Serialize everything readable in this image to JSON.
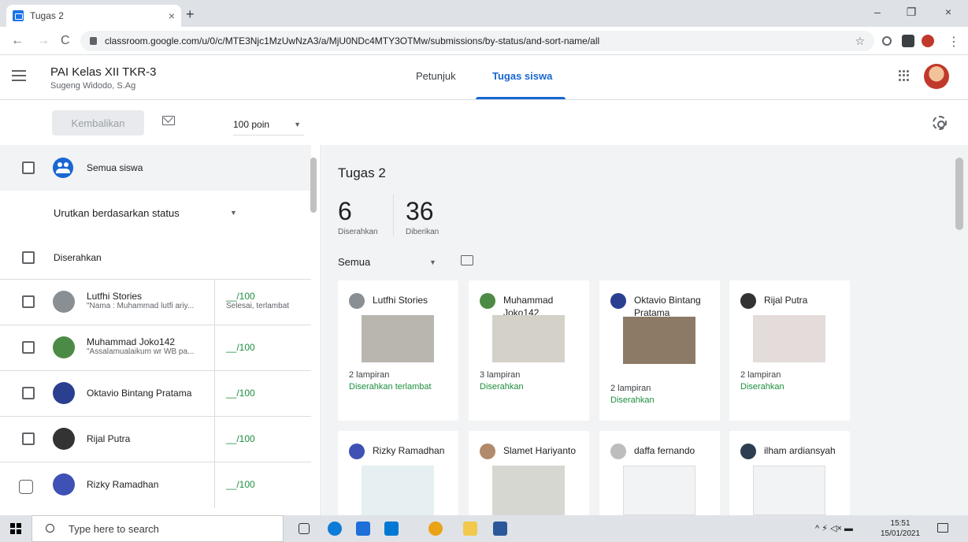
{
  "browser": {
    "tab_title": "Tugas 2",
    "tab_close": "×",
    "new_tab": "+",
    "url": "classroom.google.com/u/0/c/MTE3Njc1MzUwNzA3/a/MjU0NDc4MTY3OTMw/submissions/by-status/and-sort-name/all",
    "back": "←",
    "forward": "→",
    "reload": "C",
    "star": "☆",
    "menu": "⋮",
    "minimize": "–",
    "restore": "❐",
    "close": "×"
  },
  "header": {
    "class_name": "PAI Kelas XII TKR-3",
    "teacher": "Sugeng Widodo, S.Ag",
    "tabs": [
      {
        "label": "Petunjuk"
      },
      {
        "label": "Tugas siswa"
      }
    ]
  },
  "toolbar": {
    "return_label": "Kembalikan",
    "points": "100 poin",
    "points_arrow": "▼"
  },
  "left": {
    "all_students": "Semua siswa",
    "sort_label": "Urutkan berdasarkan status",
    "sort_arrow": "▼",
    "section": "Diserahkan",
    "students": [
      {
        "name": "Lutfhi Stories",
        "note": "\"Nama : Muhammad lutfi ariy...",
        "grade": "__/100",
        "status": "Selesai, terlambat",
        "avatar_color": "#8a8f94"
      },
      {
        "name": "Muhammad Joko142",
        "note": "\"Assalamualaikum wr WB pa...",
        "grade": "__/100",
        "status": "",
        "avatar_color": "#4c8b45"
      },
      {
        "name": "Oktavio Bintang Pratama",
        "note": "",
        "grade": "__/100",
        "status": "",
        "avatar_color": "#2a3f8f"
      },
      {
        "name": "Rijal Putra",
        "note": "",
        "grade": "__/100",
        "status": "",
        "avatar_color": "#333333"
      },
      {
        "name": "Rizky Ramadhan",
        "note": "",
        "grade": "__/100",
        "status": "",
        "avatar_color": "#3f51b5"
      }
    ]
  },
  "main": {
    "assignment_title": "Tugas 2",
    "turned_in_count": "6",
    "turned_in_label": "Diserahkan",
    "assigned_count": "36",
    "assigned_label": "Diberikan",
    "filter": "Semua",
    "filter_arrow": "▼",
    "cards": [
      {
        "name": "Lutfhi Stories",
        "attachments": "2 lampiran",
        "status": "Diserahkan terlambat",
        "avatar_color": "#8a8f94",
        "thumb_color": "#b9b6b0"
      },
      {
        "name": "Muhammad Joko142",
        "attachments": "3 lampiran",
        "status": "Diserahkan",
        "avatar_color": "#4c8b45",
        "thumb_color": "#d4d1c9"
      },
      {
        "name": "Oktavio Bintang Pratama",
        "attachments": "2 lampiran",
        "status": "Diserahkan",
        "avatar_color": "#2a3f8f",
        "thumb_color": "#8d7a66"
      },
      {
        "name": "Rijal Putra",
        "attachments": "2 lampiran",
        "status": "Diserahkan",
        "avatar_color": "#333333",
        "thumb_color": "#e4dcda"
      },
      {
        "name": "Rizky Ramadhan",
        "attachments": "",
        "status": "",
        "avatar_color": "#3f51b5",
        "thumb_color": "#e6eff2"
      },
      {
        "name": "Slamet Hariyanto",
        "attachments": "",
        "status": "",
        "avatar_color": "#b08a6a",
        "thumb_color": "#d7d7d2"
      },
      {
        "name": "daffa fernando",
        "attachments": "",
        "status": "",
        "avatar_color": "#bdbdbd",
        "thumb_color": "#f1f3f4"
      },
      {
        "name": "ilham ardiansyah",
        "attachments": "",
        "status": "",
        "avatar_color": "#2c3e50",
        "thumb_color": "#f1f3f4"
      }
    ]
  },
  "taskbar": {
    "search_placeholder": "Type here to search",
    "tray": "^ ⚡ ◁× ▬",
    "time": "15:51",
    "date": "15/01/2021"
  },
  "colors": {
    "accent": "#1967d2",
    "status_green": "#1e8e3e"
  }
}
